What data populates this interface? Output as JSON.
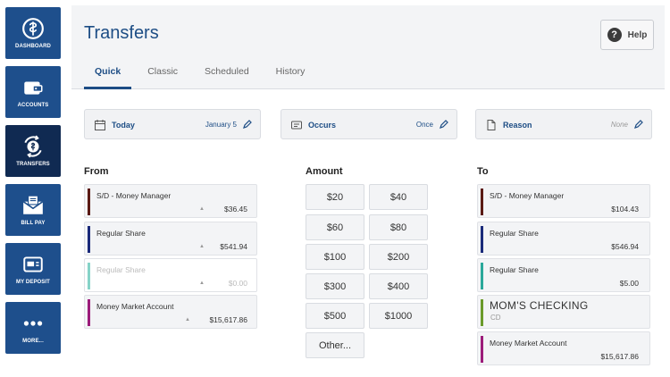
{
  "nav": [
    {
      "label": "DASHBOARD",
      "icon": "globe-dollar-icon",
      "active": false
    },
    {
      "label": "ACCOUNTS",
      "icon": "wallet-icon",
      "active": false
    },
    {
      "label": "TRANSFERS",
      "icon": "transfer-icon",
      "active": true
    },
    {
      "label": "BILL PAY",
      "icon": "envelope-icon",
      "active": false
    },
    {
      "label": "MY DEPOSIT",
      "icon": "check-deposit-icon",
      "active": false
    },
    {
      "label": "MORE...",
      "icon": "more-dots-icon",
      "active": false
    }
  ],
  "header": {
    "title": "Transfers",
    "help_label": "Help",
    "tabs": [
      {
        "label": "Quick",
        "active": true
      },
      {
        "label": "Classic",
        "active": false
      },
      {
        "label": "Scheduled",
        "active": false
      },
      {
        "label": "History",
        "active": false
      }
    ]
  },
  "options": {
    "date": {
      "label": "Today",
      "value": "January 5",
      "icon": "calendar-icon"
    },
    "occurs": {
      "label": "Occurs",
      "value": "Once",
      "icon": "repeat-icon"
    },
    "reason": {
      "label": "Reason",
      "value": "None",
      "icon": "document-icon"
    }
  },
  "from": {
    "heading": "From",
    "accounts": [
      {
        "name": "S/D - Money Manager",
        "amount": "$36.45",
        "color": "#5a1a14"
      },
      {
        "name": "Regular Share",
        "amount": "$541.94",
        "color": "#1a2a7a"
      },
      {
        "name": "Regular Share",
        "amount": "$0.00",
        "color": "#86d3c8"
      },
      {
        "name": "Money Market Account",
        "amount": "$15,617.86",
        "color": "#9c1c7a"
      }
    ]
  },
  "amount": {
    "heading": "Amount",
    "buttons": [
      "$20",
      "$40",
      "$60",
      "$80",
      "$100",
      "$200",
      "$300",
      "$400",
      "$500",
      "$1000"
    ],
    "other_label": "Other..."
  },
  "to": {
    "heading": "To",
    "accounts": [
      {
        "name": "S/D - Money Manager",
        "amount": "$104.43",
        "color": "#5a1a14"
      },
      {
        "name": "Regular Share",
        "amount": "$546.94",
        "color": "#1a2a7a"
      },
      {
        "name": "Regular Share",
        "amount": "$5.00",
        "color": "#2aa89a"
      },
      {
        "name": "MOM'S CHECKING",
        "sub": "CD",
        "amount": "",
        "color": "#6a9a2a"
      },
      {
        "name": "Money Market Account",
        "amount": "$15,617.86",
        "color": "#9c1c7a"
      }
    ]
  },
  "colors": {
    "brand": "#1e4f8c",
    "brand_dark": "#102a52",
    "accent_text": "#1d4d85"
  }
}
